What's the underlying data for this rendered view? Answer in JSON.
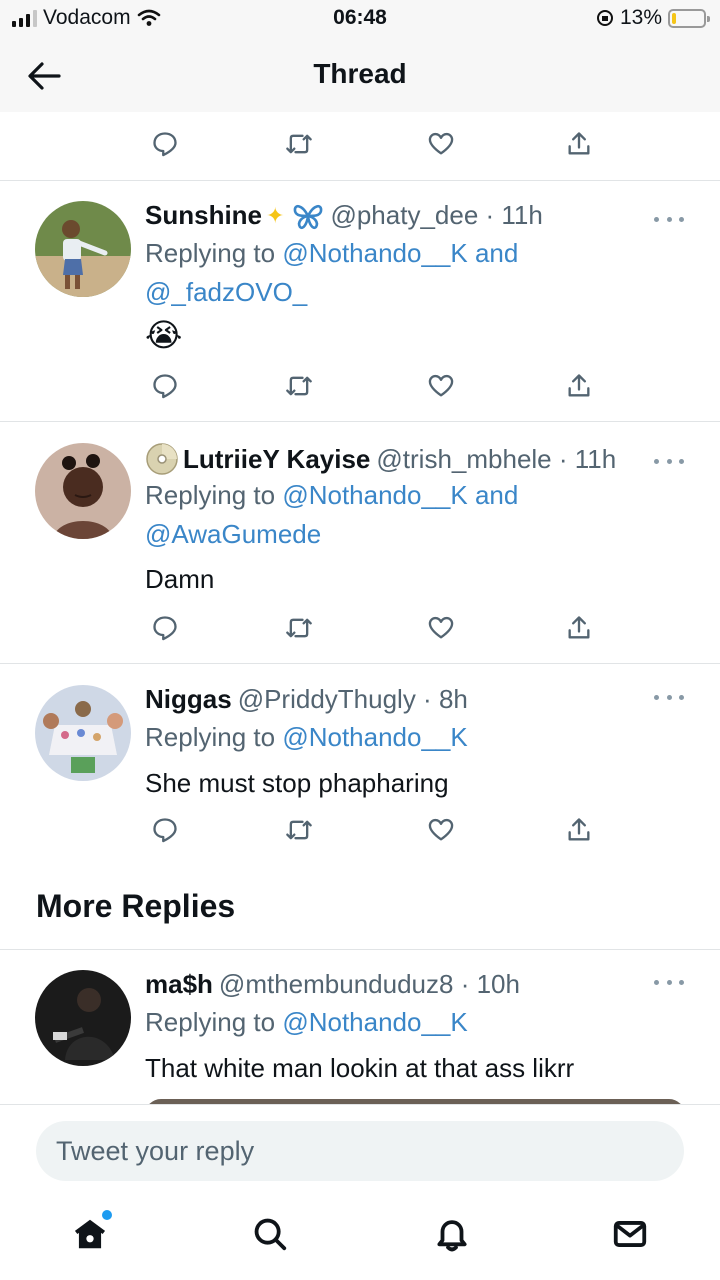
{
  "status_bar": {
    "carrier": "Vodacom",
    "time": "06:48",
    "battery": "13%",
    "battery_level": 0.13
  },
  "header": {
    "title": "Thread"
  },
  "tweets": [
    {
      "name": "Sunshine",
      "handle": "@phaty_dee",
      "time": "11h",
      "replying_prefix": "Replying to",
      "mentions_line1": "@Nothando__K and",
      "mentions_line2": "@_fadzOVO_",
      "text": "😭"
    },
    {
      "name": "LutriieY Kayise",
      "handle": "@trish_mbhele",
      "time": "11h",
      "replying_prefix": "Replying to",
      "mentions_line1": "@Nothando__K and",
      "mentions_line2": "@AwaGumede",
      "text": "Damn"
    },
    {
      "name": "Niggas",
      "handle": "@PriddyThugly",
      "time": "8h",
      "replying_prefix": "Replying to",
      "mentions_line1": "@Nothando__K",
      "text": "She must stop phapharing"
    },
    {
      "name": "ma$h",
      "handle": "@mthembunduduz8",
      "time": "10h",
      "replying_prefix": "Replying to",
      "mentions_line1": "@Nothando__K",
      "text": "That white man lookin at that ass likrr"
    }
  ],
  "more_replies": {
    "title": "More Replies"
  },
  "composer": {
    "placeholder": "Tweet your reply"
  },
  "colors": {
    "accent": "#1d9bf0",
    "mention": "#3a86c8",
    "muted": "#536471"
  }
}
